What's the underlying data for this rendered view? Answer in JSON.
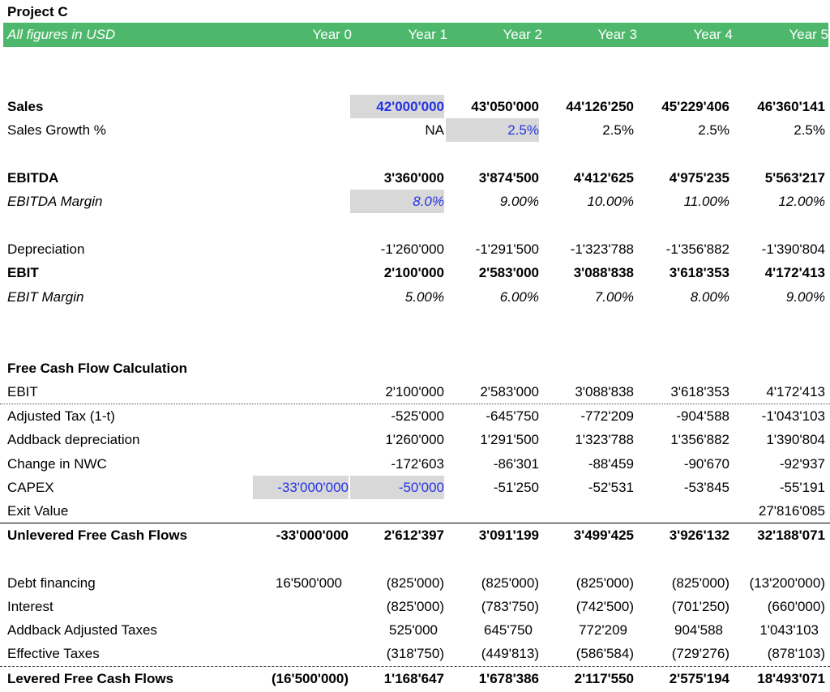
{
  "title": "Project C",
  "header": {
    "label": "All figures in USD",
    "years": [
      "Year 0",
      "Year 1",
      "Year 2",
      "Year 3",
      "Year 4",
      "Year 5"
    ]
  },
  "colors": {
    "header_bg": "#4db86b",
    "input_text": "#2433e6",
    "input_shade": "#d8d8d8"
  },
  "rows": [
    {
      "id": "sales",
      "label": "Sales",
      "values": [
        "",
        "42'000'000",
        "43'050'000",
        "44'126'250",
        "45'229'406",
        "46'360'141"
      ]
    },
    {
      "id": "sales_growth",
      "label": "Sales Growth %",
      "values": [
        "",
        "NA",
        "2.5%",
        "2.5%",
        "2.5%",
        "2.5%"
      ]
    },
    {
      "id": "ebitda",
      "label": "EBITDA",
      "values": [
        "",
        "3'360'000",
        "3'874'500",
        "4'412'625",
        "4'975'235",
        "5'563'217"
      ]
    },
    {
      "id": "ebitda_margin",
      "label": "EBITDA Margin",
      "values": [
        "",
        "8.0%",
        "9.00%",
        "10.00%",
        "11.00%",
        "12.00%"
      ]
    },
    {
      "id": "depreciation",
      "label": "Depreciation",
      "values": [
        "",
        "-1'260'000",
        "-1'291'500",
        "-1'323'788",
        "-1'356'882",
        "-1'390'804"
      ]
    },
    {
      "id": "ebit",
      "label": "EBIT",
      "values": [
        "",
        "2'100'000",
        "2'583'000",
        "3'088'838",
        "3'618'353",
        "4'172'413"
      ]
    },
    {
      "id": "ebit_margin",
      "label": "EBIT Margin",
      "values": [
        "",
        "5.00%",
        "6.00%",
        "7.00%",
        "8.00%",
        "9.00%"
      ]
    },
    {
      "id": "fcf_heading",
      "label": "Free Cash Flow Calculation",
      "values": [
        "",
        "",
        "",
        "",
        "",
        ""
      ]
    },
    {
      "id": "fcf_ebit",
      "label": "EBIT",
      "values": [
        "",
        "2'100'000",
        "2'583'000",
        "3'088'838",
        "3'618'353",
        "4'172'413"
      ]
    },
    {
      "id": "adj_tax",
      "label": "Adjusted Tax (1-t)",
      "values": [
        "",
        "-525'000",
        "-645'750",
        "-772'209",
        "-904'588",
        "-1'043'103"
      ]
    },
    {
      "id": "addback_dep",
      "label": "Addback depreciation",
      "values": [
        "",
        "1'260'000",
        "1'291'500",
        "1'323'788",
        "1'356'882",
        "1'390'804"
      ]
    },
    {
      "id": "change_nwc",
      "label": "Change in NWC",
      "values": [
        "",
        "-172'603",
        "-86'301",
        "-88'459",
        "-90'670",
        "-92'937"
      ]
    },
    {
      "id": "capex",
      "label": "CAPEX",
      "values": [
        "-33'000'000",
        "-50'000",
        "-51'250",
        "-52'531",
        "-53'845",
        "-55'191"
      ]
    },
    {
      "id": "exit_value",
      "label": "Exit Value",
      "values": [
        "",
        "",
        "",
        "",
        "",
        "27'816'085"
      ]
    },
    {
      "id": "unlevered_fcf",
      "label": "Unlevered Free Cash Flows",
      "values": [
        "-33'000'000",
        "2'612'397",
        "3'091'199",
        "3'499'425",
        "3'926'132",
        "32'188'071"
      ]
    },
    {
      "id": "debt_financing",
      "label": "Debt financing",
      "values": [
        "16'500'000",
        "(825'000)",
        "(825'000)",
        "(825'000)",
        "(825'000)",
        "(13'200'000)"
      ]
    },
    {
      "id": "interest",
      "label": "Interest",
      "values": [
        "",
        "(825'000)",
        "(783'750)",
        "(742'500)",
        "(701'250)",
        "(660'000)"
      ]
    },
    {
      "id": "addback_adj_taxes",
      "label": "Addback Adjusted Taxes",
      "values": [
        "",
        "525'000",
        "645'750",
        "772'209",
        "904'588",
        "1'043'103"
      ]
    },
    {
      "id": "effective_taxes",
      "label": "Effective Taxes",
      "values": [
        "",
        "(318'750)",
        "(449'813)",
        "(586'584)",
        "(729'276)",
        "(878'103)"
      ]
    },
    {
      "id": "levered_fcf",
      "label": "Levered Free Cash Flows",
      "values": [
        "(16'500'000)",
        "1'168'647",
        "1'678'386",
        "2'117'550",
        "2'575'194",
        "18'493'071"
      ]
    }
  ]
}
